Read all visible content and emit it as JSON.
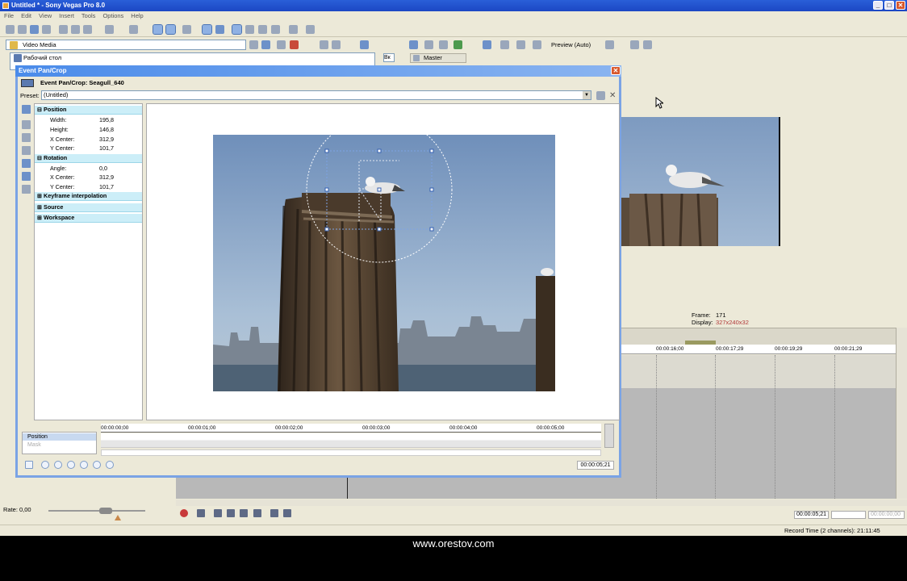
{
  "window": {
    "title": "Untitled * - Sony Vegas Pro 8.0",
    "min": "_",
    "max": "□",
    "close": "✕"
  },
  "menu": [
    "File",
    "Edit",
    "View",
    "Insert",
    "Tools",
    "Options",
    "Help"
  ],
  "explorer": {
    "path": "Video Media",
    "tree_item": "Рабочий стол",
    "tree_item2": "Вк"
  },
  "mixer": {
    "master_label": "Master"
  },
  "preview": {
    "quality": "Preview (Auto)",
    "frame_label": "Frame:",
    "frame_value": "171",
    "display_label": "Display:",
    "display_value": "327x240x32"
  },
  "timeline": {
    "ticks": [
      "00:00:16;00",
      "00:00:17;29",
      "00:00:19;29",
      "00:00:21;29"
    ]
  },
  "transport": {
    "time_current": "00:00:05;21",
    "time_b": "",
    "time_c": "00:00:00;00",
    "rate": "Rate: 0,00"
  },
  "status": {
    "record_time": "Record Time (2 channels): 21:11:45"
  },
  "dialog": {
    "title": "Event Pan/Crop",
    "close": "✕",
    "subtitle": "Event Pan/Crop: Seagull_640",
    "preset_label": "Preset:",
    "preset_value": "(Untitled)",
    "sections": {
      "position": "Position",
      "rotation": "Rotation",
      "keyframe": "Keyframe interpolation",
      "source": "Source",
      "workspace": "Workspace"
    },
    "position": [
      {
        "name": "Width:",
        "value": "195,8"
      },
      {
        "name": "Height:",
        "value": "146,8"
      },
      {
        "name": "X Center:",
        "value": "312,9"
      },
      {
        "name": "Y Center:",
        "value": "101,7"
      }
    ],
    "rotation": [
      {
        "name": "Angle:",
        "value": "0,0"
      },
      {
        "name": "X Center:",
        "value": "312,9"
      },
      {
        "name": "Y Center:",
        "value": "101,7"
      }
    ],
    "keyframes": {
      "track_position": "Position",
      "track_mask": "Mask",
      "ruler": [
        "00:00:00;00",
        "00:00:01;00",
        "00:00:02;00",
        "00:00:03;00",
        "00:00:04;00",
        "00:00:05;00"
      ],
      "time": "00:00:05;21"
    }
  },
  "footer": {
    "watermark": "www.orestov.com"
  }
}
